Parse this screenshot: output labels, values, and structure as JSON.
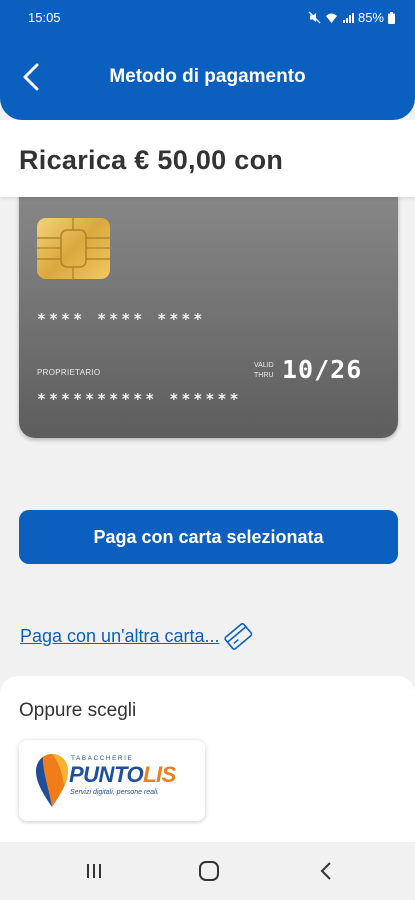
{
  "status_bar": {
    "time": "15:05",
    "battery": "85%",
    "icons": [
      "mute-icon",
      "wifi-icon",
      "signal-icon",
      "battery-icon"
    ]
  },
  "header": {
    "title": "Metodo di pagamento",
    "back_icon": "back-arrow-icon"
  },
  "amount": {
    "text": "Ricarica € 50,00 con"
  },
  "card": {
    "number": "****  ****  ****",
    "owner_label": "PROPRIETARIO",
    "valid_label_1": "VALID",
    "valid_label_2": "THRU",
    "expiry": "10/26",
    "owner_name": "**********  ******"
  },
  "actions": {
    "pay_selected": "Paga con carta selezionata",
    "pay_other": "Paga con un'altra carta..."
  },
  "alternatives": {
    "title": "Oppure scegli",
    "puntolis": {
      "top": "TABACCHERIE",
      "brand_1": "PUNTO",
      "brand_2": "LIS",
      "tagline": "Servizi digitali, persone reali."
    }
  },
  "colors": {
    "primary": "#0a5fbf",
    "puntolis_blue": "#1f4e9c",
    "puntolis_orange": "#ef7d1a"
  }
}
